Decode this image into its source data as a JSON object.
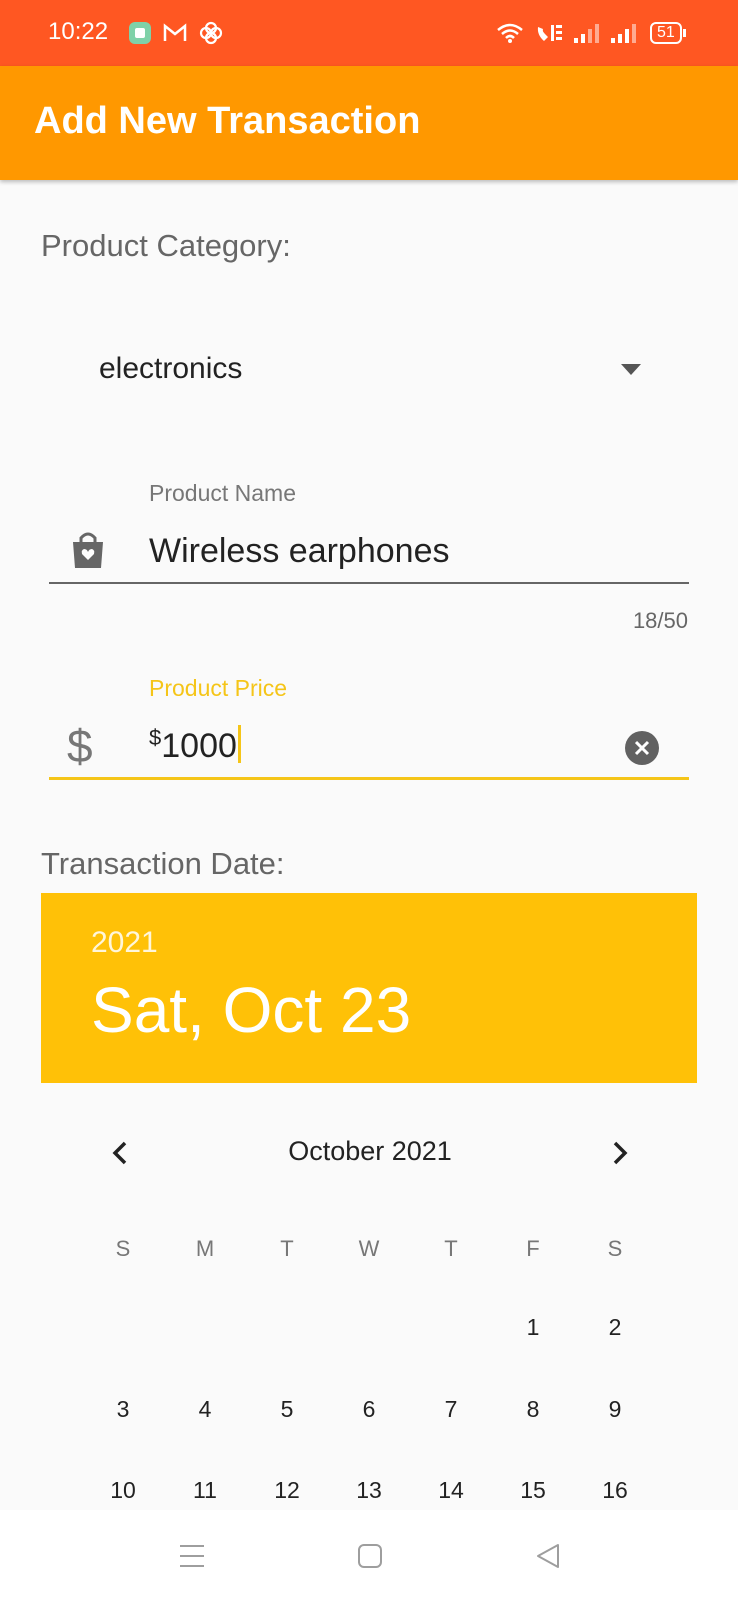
{
  "status_bar": {
    "time": "10:22",
    "battery": "51",
    "icons": [
      "app-notification-icon",
      "gmail-icon",
      "pinwheel-icon",
      "wifi-icon",
      "volte-icon",
      "signal-icon",
      "signal-icon",
      "battery-icon"
    ]
  },
  "app_bar": {
    "title": "Add New Transaction"
  },
  "form": {
    "category_label": "Product Category:",
    "category_value": "electronics",
    "name_label": "Product Name",
    "name_value": "Wireless earphones",
    "name_counter": "18/50",
    "price_label": "Product Price",
    "price_prefix": "$",
    "price_value": "1000",
    "date_label": "Transaction Date:"
  },
  "date_picker": {
    "year": "2021",
    "selected_date": "Sat, Oct 23",
    "month_label": "October 2021",
    "weekdays": [
      "S",
      "M",
      "T",
      "W",
      "T",
      "F",
      "S"
    ],
    "weeks": [
      [
        "",
        "",
        "",
        "",
        "",
        "1",
        "2"
      ],
      [
        "3",
        "4",
        "5",
        "6",
        "7",
        "8",
        "9"
      ],
      [
        "10",
        "11",
        "12",
        "13",
        "14",
        "15",
        "16"
      ]
    ]
  },
  "colors": {
    "status_bar": "#ff5722",
    "app_bar": "#ff9800",
    "accent": "#f5c518",
    "date_header": "#ffc107"
  }
}
